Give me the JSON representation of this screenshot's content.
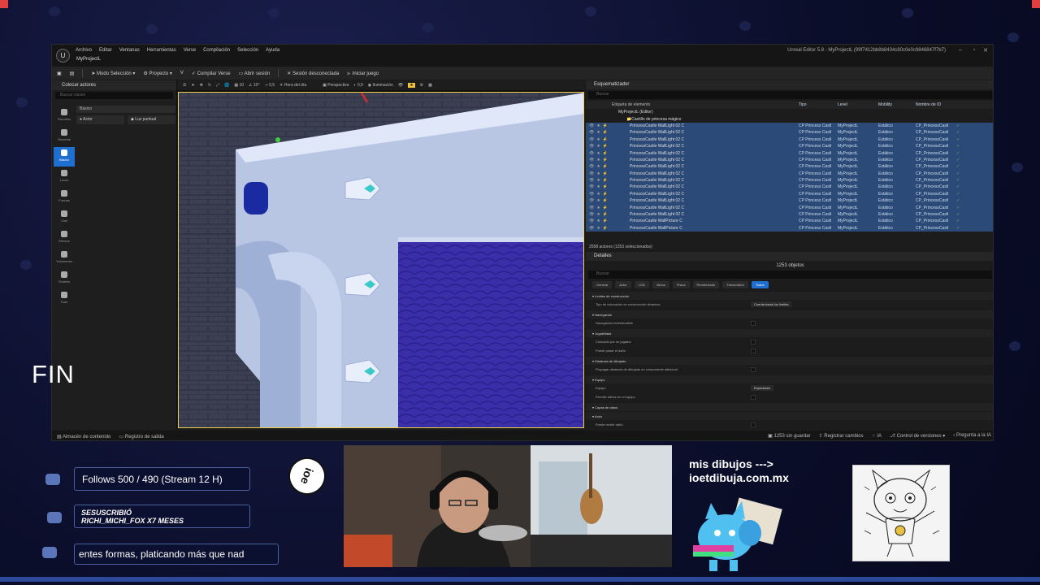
{
  "editor": {
    "menu": [
      "Archivo",
      "Editar",
      "Ventanas",
      "Herramientas",
      "Verse",
      "Compilación",
      "Selección",
      "Ayuda"
    ],
    "project_tab": "MyProjectL",
    "window_title": "Unreal Editor 5.8 - MyProjectL (99f7412bb8b8434c80c0e0c9846847f7b7)",
    "toolbar": {
      "mode": "Modo Selección",
      "project": "Proyecto",
      "compile": "Compilar Verse",
      "open_session": "Abrir sesión",
      "session_status": "Sesión desconectada",
      "start_game": "Iniciar juego"
    },
    "place_actors": {
      "tab": "Colocar actores",
      "search_placeholder": "Buscar clases",
      "categories": [
        "Favoritos",
        "Reciente",
        "Básico",
        "Luces",
        "Formas",
        "Cine",
        "Efectos",
        "Volúmenes",
        "Síntesis",
        "Todo"
      ],
      "section": "Básico",
      "items": [
        "Actor",
        "Luz puntual"
      ]
    },
    "viewport": {
      "view": "Perspectiva",
      "lighting": "Iluminación",
      "time_of_day": "Hora del día",
      "speed": "0,5",
      "fov": "10°",
      "grid": "10",
      "snap": "0,9"
    },
    "outliner": {
      "tab": "Esquematizador",
      "search_placeholder": "Buscar",
      "columns": [
        "Etiqueta de elemento",
        "Tipo",
        "Level",
        "Mobility",
        "Nombre de ID"
      ],
      "root": "MyProjectL (Editor)",
      "folder": "Castillo de princesa mágico",
      "rows": [
        {
          "label": "PrincessCastle WallLight 02 C",
          "type": "CP Princess Castl",
          "level": "MyProjectL",
          "mobility": "Estático",
          "id": "CP_PrincessCastl"
        },
        {
          "label": "PrincessCastle WallLight 02 C",
          "type": "CP Princess Castl",
          "level": "MyProjectL",
          "mobility": "Estático",
          "id": "CP_PrincessCastl"
        },
        {
          "label": "PrincessCastle WallLight 02 C",
          "type": "CP Princess Castl",
          "level": "MyProjectL",
          "mobility": "Estático",
          "id": "CP_PrincessCastl"
        },
        {
          "label": "PrincessCastle WallLight 02 C",
          "type": "CP Princess Castl",
          "level": "MyProjectL",
          "mobility": "Estático",
          "id": "CP_PrincessCastl"
        },
        {
          "label": "PrincessCastle WallLight 02 C",
          "type": "CP Princess Castl",
          "level": "MyProjectL",
          "mobility": "Estático",
          "id": "CP_PrincessCastl"
        },
        {
          "label": "PrincessCastle WallLight 02 C",
          "type": "CP Princess Castl",
          "level": "MyProjectL",
          "mobility": "Estático",
          "id": "CP_PrincessCastl"
        },
        {
          "label": "PrincessCastle WallLight 02 C",
          "type": "CP Princess Castl",
          "level": "MyProjectL",
          "mobility": "Estático",
          "id": "CP_PrincessCastl"
        },
        {
          "label": "PrincessCastle WallLight 02 C",
          "type": "CP Princess Castl",
          "level": "MyProjectL",
          "mobility": "Estático",
          "id": "CP_PrincessCastl"
        },
        {
          "label": "PrincessCastle WallLight 02 C",
          "type": "CP Princess Castl",
          "level": "MyProjectL",
          "mobility": "Estático",
          "id": "CP_PrincessCastl"
        },
        {
          "label": "PrincessCastle WallLight 02 C",
          "type": "CP Princess Castl",
          "level": "MyProjectL",
          "mobility": "Estático",
          "id": "CP_PrincessCastl"
        },
        {
          "label": "PrincessCastle WallLight 02 C",
          "type": "CP Princess Castl",
          "level": "MyProjectL",
          "mobility": "Estático",
          "id": "CP_PrincessCastl"
        },
        {
          "label": "PrincessCastle WallLight 02 C",
          "type": "CP Princess Castl",
          "level": "MyProjectL",
          "mobility": "Estático",
          "id": "CP_PrincessCastl"
        },
        {
          "label": "PrincessCastle WallLight 02 C",
          "type": "CP Princess Castl",
          "level": "MyProjectL",
          "mobility": "Estático",
          "id": "CP_PrincessCastl"
        },
        {
          "label": "PrincessCastle WallLight 02 C",
          "type": "CP Princess Castl",
          "level": "MyProjectL",
          "mobility": "Estático",
          "id": "CP_PrincessCastl"
        },
        {
          "label": "PrincessCastle WallPicture C",
          "type": "CP Princess Castl",
          "level": "MyProjectL",
          "mobility": "Estático",
          "id": "CP_PrincessCastl"
        },
        {
          "label": "PrincessCastle WallPicture C",
          "type": "CP Princess Castl",
          "level": "MyProjectL",
          "mobility": "Estático",
          "id": "CP_PrincessCastl"
        }
      ],
      "footer": "2558 actores (1253 seleccionados)"
    },
    "details": {
      "tab": "Detalles",
      "count": "1253 objetos",
      "search_placeholder": "Buscar",
      "filters": [
        "General",
        "Actor",
        "LOD",
        "Varios",
        "Física",
        "Renderizado",
        "Transmisión",
        "Todos"
      ],
      "active_filter": "Todos",
      "sections": [
        {
          "title": "Límites de construcción",
          "props": [
            {
              "name": "Tipo de colocación en construcción dinámica",
              "value": "Cuenta hacia los límites"
            }
          ]
        },
        {
          "title": "Navegación",
          "props": [
            {
              "name": "Navegación indestructible",
              "value": ""
            }
          ]
        },
        {
          "title": "Jugabilidad",
          "props": [
            {
              "name": "Colocado por un jugador",
              "value": ""
            },
            {
              "name": "Puede pasar el daño",
              "value": ""
            }
          ]
        },
        {
          "title": "Distancia de dibujado",
          "props": [
            {
              "name": "Propagar distancia de dibujado en componente adicional",
              "value": ""
            }
          ]
        },
        {
          "title": "Equipo",
          "props": [
            {
              "name": "Equipo",
              "value": "Espectador"
            },
            {
              "name": "Permitir daños en el equipo",
              "value": ""
            }
          ]
        },
        {
          "title": "Capas de datos",
          "props": []
        },
        {
          "title": "Actor",
          "props": [
            {
              "name": "Puede recibir daño",
              "value": ""
            }
          ]
        }
      ]
    },
    "statusbar": {
      "content_drawer": "Almacén de contenido",
      "output_log": "Registro de salida",
      "unsaved": "1253 sin guardar",
      "record_changes": "Registrar cambios",
      "ai": "IA",
      "version_control": "Control de versiones",
      "ask_ai": "Pregunta a la IA"
    }
  },
  "overlay": {
    "fin": "FIN",
    "follows": "Follows 500 / 490 (Stream 12 H)",
    "sub_line1": "SESUSCRIBIÓ",
    "sub_line2": "RICHI_MICHI_FOX X7 MESES",
    "ticker": "entes formas, platicando más que nad",
    "badge": "ioe",
    "promo_line1": "mis dibujos --->",
    "promo_line2": "ioetdibuja.com.mx"
  },
  "colors": {
    "accent_blue": "#1f6fd0",
    "selection_row": "#2c4a78",
    "viewport_border": "#f2d24a",
    "stream_bg": "#0b0e2a"
  }
}
